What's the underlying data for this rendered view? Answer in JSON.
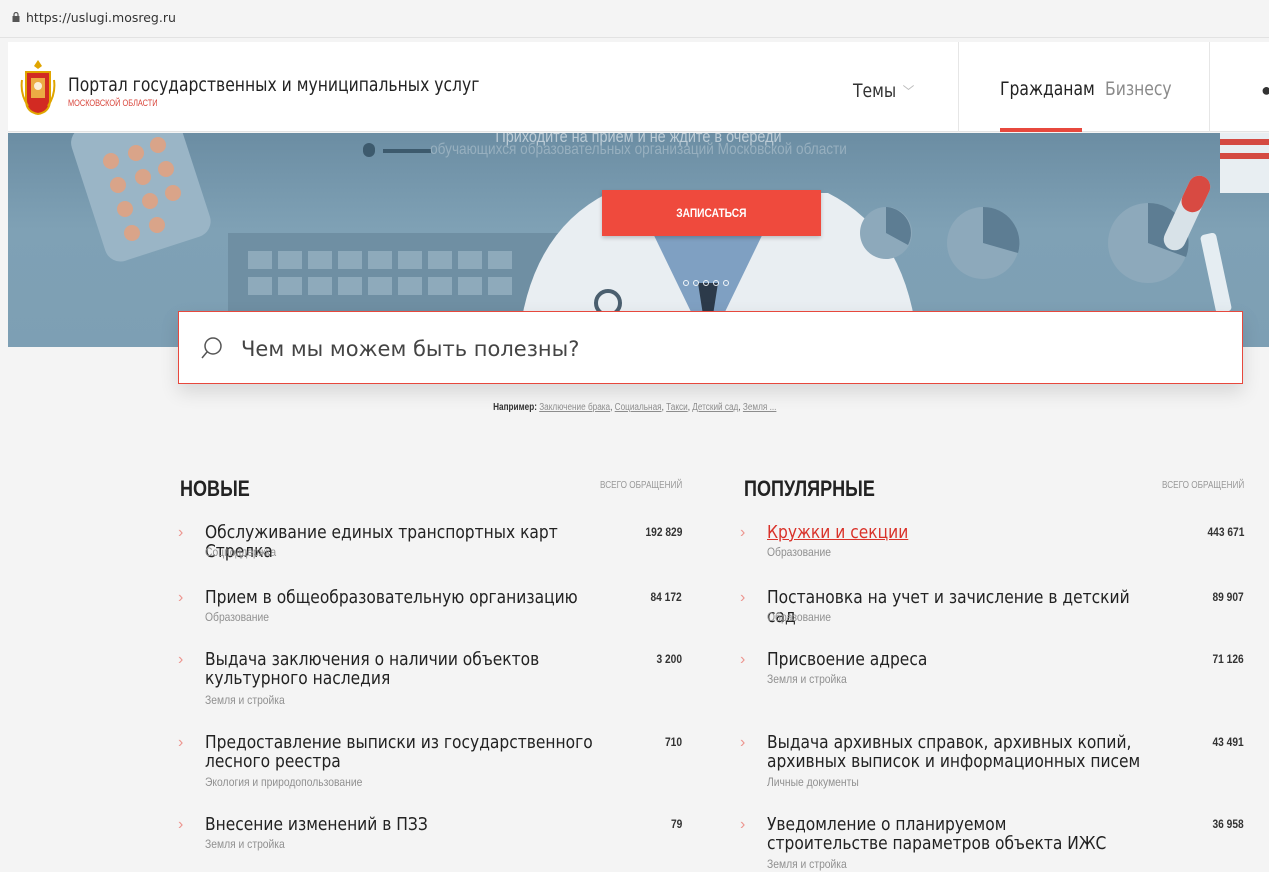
{
  "browser": {
    "url": "https://uslugi.mosreg.ru"
  },
  "header": {
    "title": "Портал государственных и муниципальных услуг",
    "subtitle": "МОСКОВСКОЙ ОБЛАСТИ",
    "nav": {
      "themes": "Темы",
      "citizens": "Гражданам",
      "business": "Бизнесу"
    }
  },
  "hero": {
    "title": "Приходите на прием и не ждите в очереди",
    "subtitle": "обучающихся образовательных организаций Московской области",
    "button": "ЗАПИСАТЬСЯ",
    "slides": 5
  },
  "search": {
    "placeholder": "Чем мы можем быть полезны?",
    "examples_label": "Например:",
    "examples": [
      "Заключение брака",
      "Социальная",
      "Такси",
      "Детский сад",
      "Земля ..."
    ]
  },
  "new_list": {
    "heading": "НОВЫЕ",
    "meta": "ВСЕГО ОБРАЩЕНИЙ",
    "items": [
      {
        "title": "Обслуживание единых транспортных карт Стрелка",
        "category": "Соцподдержка",
        "count": "192 829"
      },
      {
        "title": "Прием в общеобразовательную организацию",
        "category": "Образование",
        "count": "84 172"
      },
      {
        "title": "Выдача заключения о наличии объектов культурного наследия",
        "category": "Земля и стройка",
        "count": "3 200"
      },
      {
        "title": "Предоставление выписки из государственного лесного реестра",
        "category": "Экология и природопользование",
        "count": "710"
      },
      {
        "title": "Внесение изменений в ПЗЗ",
        "category": "Земля и стройка",
        "count": "79"
      }
    ]
  },
  "popular_list": {
    "heading": "ПОПУЛЯРНЫЕ",
    "meta": "ВСЕГО ОБРАЩЕНИЙ",
    "items": [
      {
        "title": "Кружки и секции",
        "category": "Образование",
        "count": "443 671"
      },
      {
        "title": "Постановка на учет и зачисление в детский сад",
        "category": "Образование",
        "count": "89 907"
      },
      {
        "title": "Присвоение адреса",
        "category": "Земля и стройка",
        "count": "71 126"
      },
      {
        "title": "Выдача архивных справок, архивных копий, архивных выписок и информационных писем",
        "category": "Личные документы",
        "count": "43 491"
      },
      {
        "title": "Уведомление о планируемом строительстве параметров объекта ИЖС",
        "category": "Земля и стройка",
        "count": "36 958"
      }
    ]
  },
  "colors": {
    "accent": "#e7483d",
    "link": "#d9322a",
    "hero": "#7d9fb4"
  },
  "icons": [
    "lock-icon",
    "crest-icon",
    "chevron-down-icon",
    "search-icon",
    "chevron-right-icon"
  ]
}
